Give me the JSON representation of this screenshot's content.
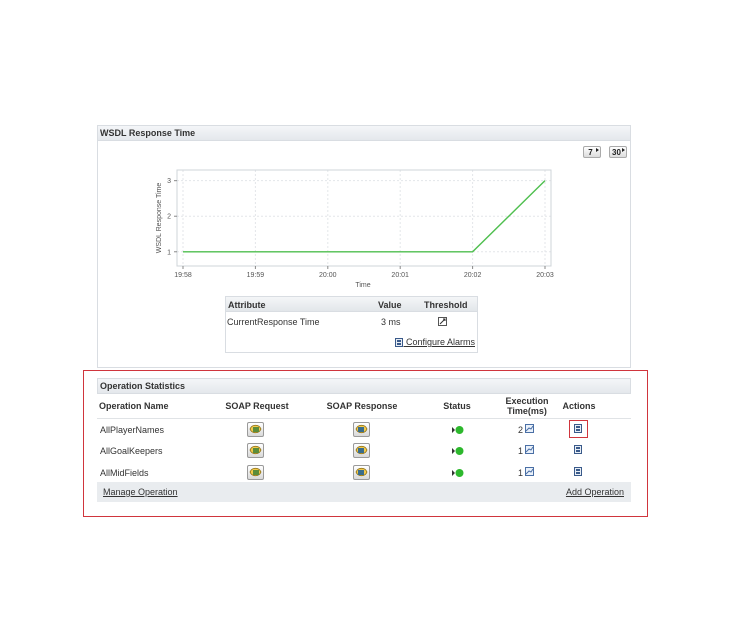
{
  "response_panel": {
    "title": "WSDL Response Time",
    "period_buttons": [
      "7",
      "30"
    ]
  },
  "chart_data": {
    "type": "line",
    "xlabel": "Time",
    "ylabel": "WSDL Response Time",
    "x": [
      "19:58",
      "19:59",
      "20:00",
      "20:01",
      "20:02",
      "20:03"
    ],
    "series": [
      {
        "values": [
          1,
          1,
          1,
          1,
          1,
          3
        ],
        "color": "#4fbf4f"
      }
    ],
    "yticks": [
      1,
      2,
      3
    ],
    "ylim": [
      0.6,
      3.3
    ],
    "grid": true,
    "legend": "none"
  },
  "attr_table": {
    "headers": [
      "Attribute",
      "Value",
      "Threshold"
    ],
    "rows": [
      {
        "attribute": "CurrentResponse Time",
        "value": "3 ms"
      }
    ],
    "configure_link": "Configure Alarms"
  },
  "operations": {
    "title": "Operation Statistics",
    "headers": {
      "name": "Operation Name",
      "soap_request": "SOAP Request",
      "soap_response": "SOAP Response",
      "status": "Status",
      "exec_time_line1": "Execution",
      "exec_time_line2": "Time(ms)",
      "actions": "Actions"
    },
    "rows": [
      {
        "name": "AllPlayerNames",
        "exec_time": "2"
      },
      {
        "name": "AllGoalKeepers",
        "exec_time": "1"
      },
      {
        "name": "AllMidFields",
        "exec_time": "1"
      }
    ],
    "footer": {
      "manage_link": "Manage Operation",
      "add_link": "Add Operation"
    }
  },
  "colors": {
    "accent_red": "#d0353d",
    "status_green": "#2db82d",
    "line_green": "#4fbf4f"
  }
}
